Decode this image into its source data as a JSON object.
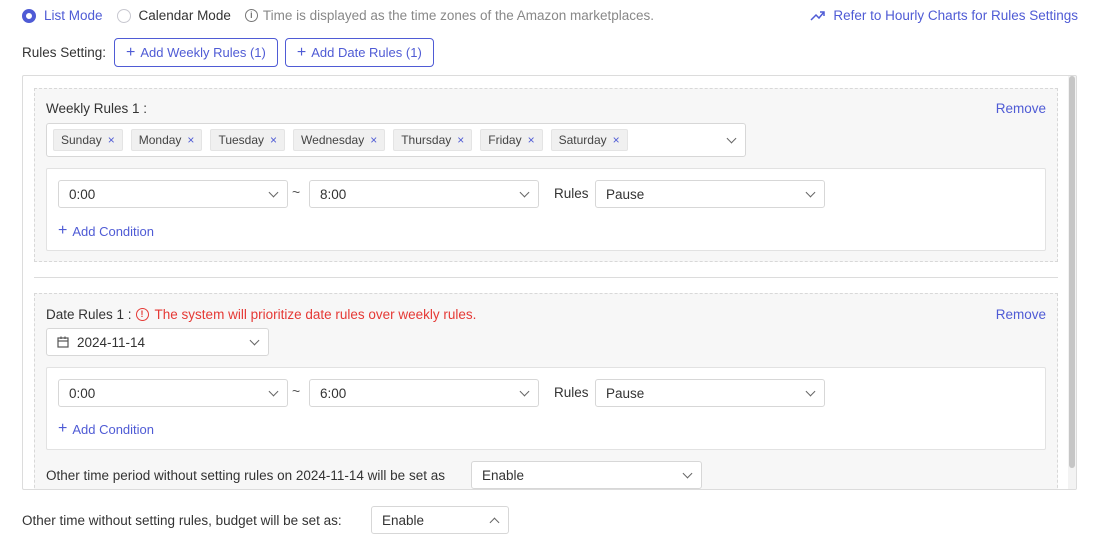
{
  "top": {
    "mode_list": "List Mode",
    "mode_calendar": "Calendar Mode",
    "info_text": "Time is displayed as the time zones of the Amazon marketplaces.",
    "hourly_link": "Refer to Hourly Charts for Rules Settings"
  },
  "rules_setting": {
    "label": "Rules Setting:",
    "add_weekly": "Add Weekly Rules (1)",
    "add_date": "Add Date Rules (1)"
  },
  "weekly": {
    "title": "Weekly Rules 1 :",
    "remove": "Remove",
    "days": [
      "Sunday",
      "Monday",
      "Tuesday",
      "Wednesday",
      "Thursday",
      "Friday",
      "Saturday"
    ],
    "start": "0:00",
    "end": "8:00",
    "rules_label": "Rules",
    "rule_value": "Pause",
    "add_condition": "Add Condition"
  },
  "date": {
    "title": "Date Rules 1 :",
    "warning": "The system will prioritize date rules over weekly rules.",
    "remove": "Remove",
    "date_value": "2024-11-14",
    "start": "0:00",
    "end": "6:00",
    "rules_label": "Rules",
    "rule_value": "Pause",
    "add_condition": "Add Condition",
    "other_label": "Other time period without setting rules on 2024-11-14 will be set as",
    "other_value": "Enable"
  },
  "footer": {
    "label": "Other time without setting rules, budget will be set as:",
    "value": "Enable"
  },
  "colors": {
    "accent": "#4f5bd5",
    "warning": "#e53935"
  }
}
